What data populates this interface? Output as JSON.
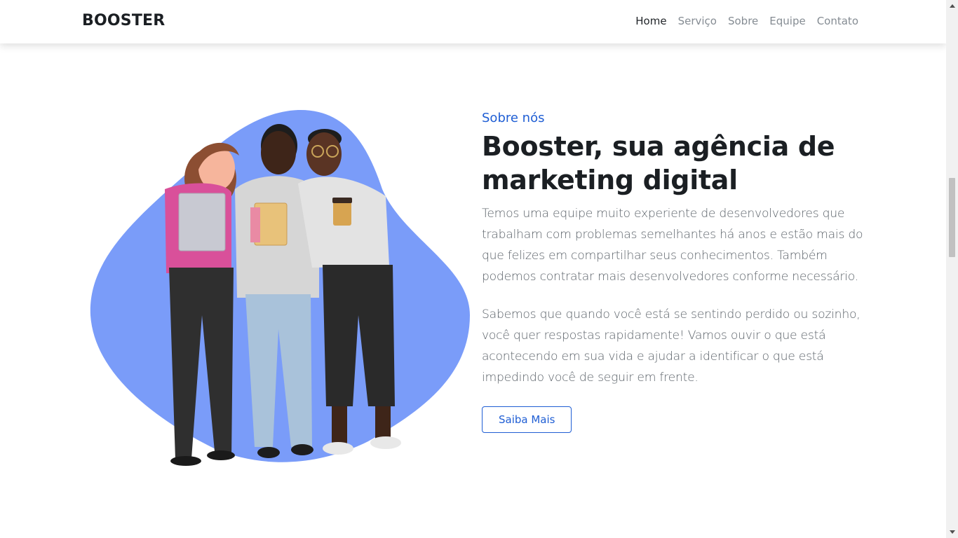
{
  "navbar": {
    "brand": "BOOSTER",
    "links": [
      {
        "label": "Home",
        "active": true
      },
      {
        "label": "Serviço",
        "active": false
      },
      {
        "label": "Sobre",
        "active": false
      },
      {
        "label": "Equipe",
        "active": false
      },
      {
        "label": "Contato",
        "active": false
      }
    ]
  },
  "about": {
    "eyebrow": "Sobre nós",
    "headline_line1": "Booster, sua agência de",
    "headline_line2": "marketing digital",
    "paragraph1": "Temos uma equipe muito experiente de desenvolvedores que trabalham com problemas semelhantes há anos e estão mais do que felizes em compartilhar seus conhecimentos. Também podemos contratar mais desenvolvedores conforme necessário.",
    "paragraph2": "Sabemos que quando você está se sentindo perdido ou sozinho, você quer respostas rapidamente! Vamos ouvir o que está acontecendo em sua vida e ajudar a identificar o que está impedindo você de seguir em frente.",
    "button_label": "Saiba Mais"
  },
  "illustration": {
    "description_icon": "team-of-three-people-illustration",
    "blob_color": "#7a9cf9"
  },
  "colors": {
    "accent": "#1f5ed4",
    "text_dark": "#1b1f23",
    "text_muted": "#5c636a",
    "nav_inactive": "#858c93"
  }
}
